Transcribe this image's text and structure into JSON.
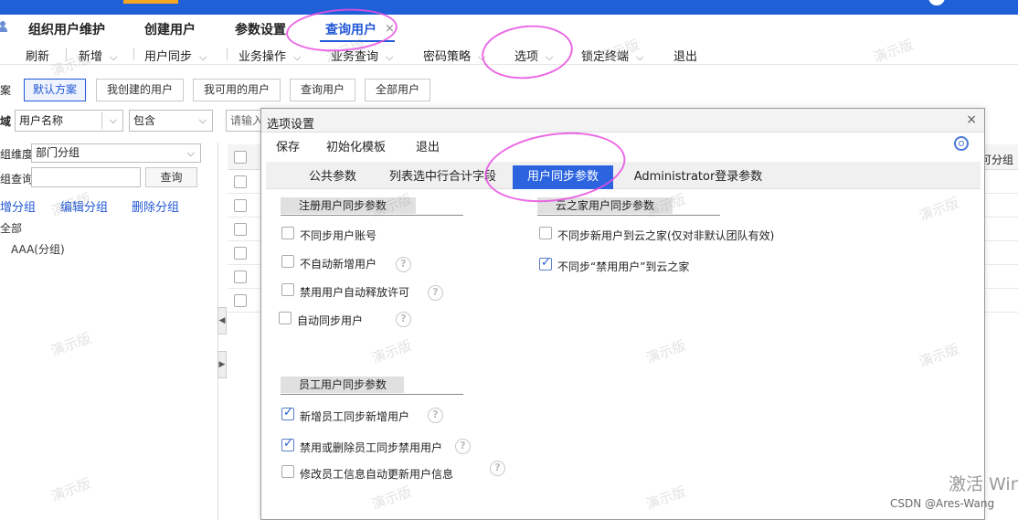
{
  "header": {
    "tabs": [
      {
        "label": "组织用户维护"
      },
      {
        "label": "创建用户"
      },
      {
        "label": "参数设置"
      },
      {
        "label": "查询用户",
        "active": true
      }
    ],
    "close_glyph": "×"
  },
  "menubar": {
    "items": [
      {
        "label": "刷新",
        "has_arrow": false
      },
      {
        "label": "新增",
        "has_arrow": true
      },
      {
        "label": "用户同步",
        "has_arrow": true
      },
      {
        "label": "业务操作",
        "has_arrow": true
      },
      {
        "label": "业务查询",
        "has_arrow": true
      },
      {
        "label": "密码策略",
        "has_arrow": true
      },
      {
        "label": "选项",
        "has_arrow": true
      },
      {
        "label": "锁定终端",
        "has_arrow": true
      },
      {
        "label": "退出",
        "has_arrow": false
      }
    ],
    "arrow_glyph": "⌵"
  },
  "scheme": {
    "label": "案",
    "buttons": [
      "默认方案",
      "我创建的用户",
      "我可用的用户",
      "查询用户",
      "全部用户"
    ]
  },
  "filter": {
    "label": "域",
    "field_select": "用户名称",
    "op_select": "包含",
    "value_placeholder": "请输入"
  },
  "left_panel": {
    "dimension_label": "组维度",
    "dimension_value": "部门分组",
    "query_label": "组查询",
    "query_value": "",
    "query_button": "查询",
    "actions": [
      "增分组",
      "编辑分组",
      "删除分组"
    ],
    "tree": [
      "全部",
      "AAA(分组)"
    ]
  },
  "grid": {
    "right_header": "可分组",
    "row_count": 6
  },
  "dialog": {
    "title": "选项设置",
    "close": "×",
    "toolbar": [
      "保存",
      "初始化模板",
      "退出"
    ],
    "tabs": [
      "公共参数",
      "列表选中行合计字段",
      "用户同步参数",
      "Administrator登录参数"
    ],
    "active_tab": "用户同步参数",
    "sections": {
      "register": {
        "title": "注册用户同步参数",
        "options": [
          {
            "label": "不同步用户账号",
            "checked": false,
            "help": false
          },
          {
            "label": "不自动新增用户",
            "checked": false,
            "help": true
          },
          {
            "label": "禁用用户自动释放许可",
            "checked": false,
            "help": true
          },
          {
            "label": "自动同步用户",
            "checked": false,
            "help": true
          }
        ]
      },
      "cloud": {
        "title": "云之家用户同步参数",
        "options": [
          {
            "label": "不同步新用户到云之家(仅对非默认团队有效)",
            "checked": false
          },
          {
            "label": "不同步“禁用用户”到云之家",
            "checked": true
          }
        ]
      },
      "employee": {
        "title": "员工用户同步参数",
        "options": [
          {
            "label": "新增员工同步新增用户",
            "checked": true,
            "help": true
          },
          {
            "label": "禁用或删除员工同步禁用用户",
            "checked": true,
            "help": true
          },
          {
            "label": "修改员工信息自动更新用户信息",
            "checked": false,
            "help": true
          }
        ]
      }
    },
    "help_glyph": "?"
  },
  "watermark_text": "演示版",
  "windows_activation": "激活 Win",
  "csdn_credit": "CSDN @Ares-Wang",
  "colors": {
    "brand_blue": "#1f5fd8",
    "active_tab": "#2c64e0",
    "annotation": "#e84fe0"
  }
}
